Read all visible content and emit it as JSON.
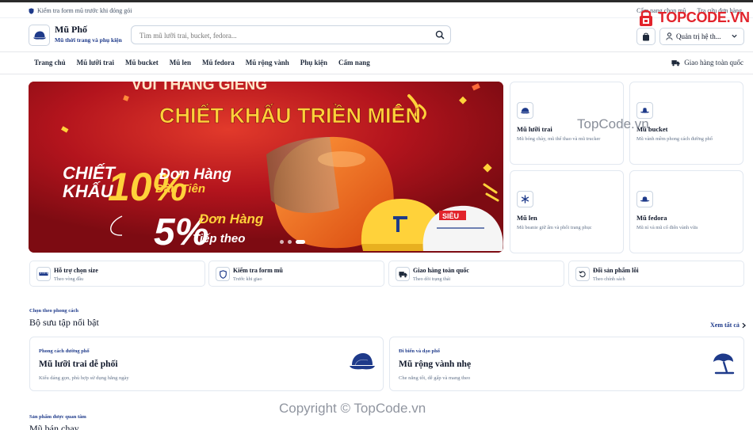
{
  "utility": {
    "left_text": "Kiểm tra form mũ trước khi đóng gói",
    "links": [
      "Cẩm nang chọn mũ",
      "Tra cứu đơn hàng"
    ]
  },
  "brand_logo": {
    "text": "TOPCODE.VN",
    "color": "#e2232b"
  },
  "header": {
    "store_name": "Mũ Phố",
    "tagline": "Mũ thời trang và phụ kiện",
    "search_placeholder": "Tìm mũ lưỡi trai, bucket, fedora...",
    "account_label": "Quản trị hệ th..."
  },
  "nav": {
    "items": [
      "Trang chủ",
      "Mũ lưỡi trai",
      "Mũ bucket",
      "Mũ len",
      "Mũ fedora",
      "Mũ rộng vành",
      "Phụ kiện",
      "Cẩm nang"
    ],
    "shipping": "Giao hàng toàn quốc"
  },
  "hero": {
    "top_text": "VUI THÁNG GIÊNG",
    "headline": "CHIẾT KHẤU TRIỀN MIÊN",
    "left_line1": "CHIẾT",
    "left_line2": "KHẤU",
    "percent1": "10%",
    "offer1_line1": "Đơn Hàng",
    "offer1_line2": "Đầu Tiên",
    "percent2": "5%",
    "offer2_line1": "Đơn Hàng",
    "offer2_line2": "Tiếp theo",
    "helmet_label": "SIÊU",
    "slide_count": 3,
    "active_slide": 3,
    "colors": {
      "bg": "#a0161f",
      "yellow": "#ffd23a",
      "orange": "#f26a1b"
    }
  },
  "categories": [
    {
      "name": "Mũ lưỡi trai",
      "desc": "Mũ bóng chày, mũ thể thao và mũ trucker",
      "icon": "cap-icon"
    },
    {
      "name": "Mũ bucket",
      "desc": "Mũ vành mềm phong cách đường phố",
      "icon": "bucket-hat-icon"
    },
    {
      "name": "Mũ len",
      "desc": "Mũ beanie giữ ấm và phối trang phục",
      "icon": "snowflake-icon"
    },
    {
      "name": "Mũ fedora",
      "desc": "Mũ nỉ và mũ cổ điển vành vừa",
      "icon": "fedora-icon"
    }
  ],
  "features": [
    {
      "title": "Hỗ trợ chọn size",
      "sub": "Theo vòng đầu",
      "icon": "ruler-icon"
    },
    {
      "title": "Kiểm tra form mũ",
      "sub": "Trước khi giao",
      "icon": "shield-icon"
    },
    {
      "title": "Giao hàng toàn quốc",
      "sub": "Theo dõi trạng thái",
      "icon": "truck-icon"
    },
    {
      "title": "Đổi sản phẩm lỗi",
      "sub": "Theo chính sách",
      "icon": "refresh-icon"
    }
  ],
  "collections_section": {
    "kicker": "Chọn theo phong cách",
    "title": "Bộ sưu tập nổi bật",
    "see_all": "Xem tất cả",
    "items": [
      {
        "kicker": "Phong cách đường phố",
        "title": "Mũ lưỡi trai dễ phối",
        "desc": "Kiểu dáng gọn, phù hợp sử dụng hằng ngày",
        "icon": "cap-icon"
      },
      {
        "kicker": "Đi biển và dạo phố",
        "title": "Mũ rộng vành nhẹ",
        "desc": "Che nắng tốt, dễ gấp và mang theo",
        "icon": "beach-umbrella-icon"
      }
    ]
  },
  "bestseller_section": {
    "kicker": "Sản phẩm được quan tâm",
    "title": "Mũ bán chạy"
  },
  "watermarks": [
    "TopCode.vn",
    "Copyright © TopCode.vn"
  ],
  "accent": "#1e3a8a"
}
